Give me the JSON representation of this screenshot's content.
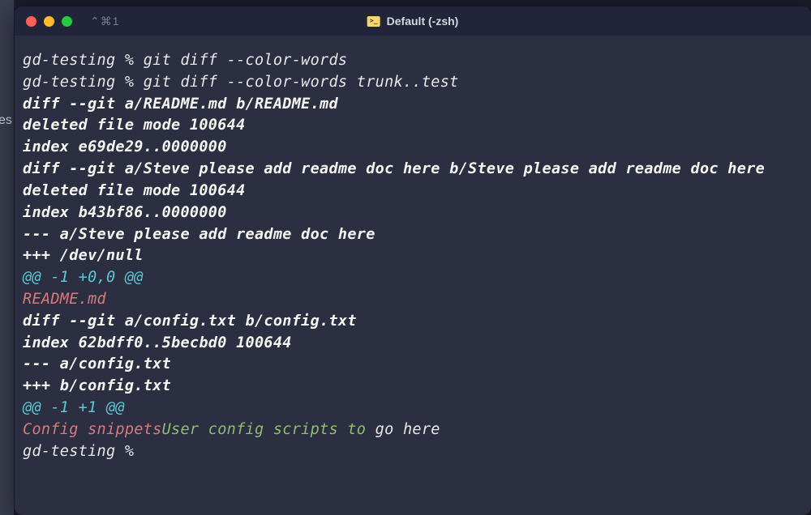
{
  "titlebar": {
    "shortcut": "⌃⌘1",
    "title": "Default (-zsh)"
  },
  "terminal": {
    "lines": [
      {
        "segments": [
          {
            "cls": "prompt",
            "text": "gd-testing % "
          },
          {
            "cls": "cmd",
            "text": "git diff --color-words"
          }
        ]
      },
      {
        "segments": [
          {
            "cls": "prompt",
            "text": "gd-testing % "
          },
          {
            "cls": "cmd",
            "text": "git diff --color-words trunk..test"
          }
        ]
      },
      {
        "segments": [
          {
            "cls": "white",
            "text": "diff --git a/README.md b/README.md"
          }
        ]
      },
      {
        "segments": [
          {
            "cls": "white",
            "text": "deleted file mode 100644"
          }
        ]
      },
      {
        "segments": [
          {
            "cls": "white",
            "text": "index e69de29..0000000"
          }
        ]
      },
      {
        "segments": [
          {
            "cls": "white",
            "text": "diff --git a/Steve please add readme doc here b/Steve please add readme doc here"
          }
        ]
      },
      {
        "segments": [
          {
            "cls": "white",
            "text": "deleted file mode 100644"
          }
        ]
      },
      {
        "segments": [
          {
            "cls": "white",
            "text": "index b43bf86..0000000"
          }
        ]
      },
      {
        "segments": [
          {
            "cls": "white",
            "text": "--- a/Steve please add readme doc here"
          }
        ]
      },
      {
        "segments": [
          {
            "cls": "white",
            "text": "+++ /dev/null"
          }
        ]
      },
      {
        "segments": [
          {
            "cls": "cyan",
            "text": "@@ -1 +0,0 @@"
          }
        ]
      },
      {
        "segments": [
          {
            "cls": "red",
            "text": "README.md"
          }
        ]
      },
      {
        "segments": [
          {
            "cls": "white",
            "text": "diff --git a/config.txt b/config.txt"
          }
        ]
      },
      {
        "segments": [
          {
            "cls": "white",
            "text": "index 62bdff0..5becbd0 100644"
          }
        ]
      },
      {
        "segments": [
          {
            "cls": "white",
            "text": "--- a/config.txt"
          }
        ]
      },
      {
        "segments": [
          {
            "cls": "white",
            "text": "+++ b/config.txt"
          }
        ]
      },
      {
        "segments": [
          {
            "cls": "cyan",
            "text": "@@ -1 +1 @@"
          }
        ]
      },
      {
        "segments": [
          {
            "cls": "red",
            "text": "Config snippets"
          },
          {
            "cls": "green",
            "text": "User config scripts to"
          },
          {
            "cls": "normal",
            "text": " go here"
          }
        ]
      },
      {
        "segments": [
          {
            "cls": "prompt",
            "text": "gd-testing % "
          }
        ]
      }
    ]
  },
  "edge": {
    "partial": "es"
  }
}
